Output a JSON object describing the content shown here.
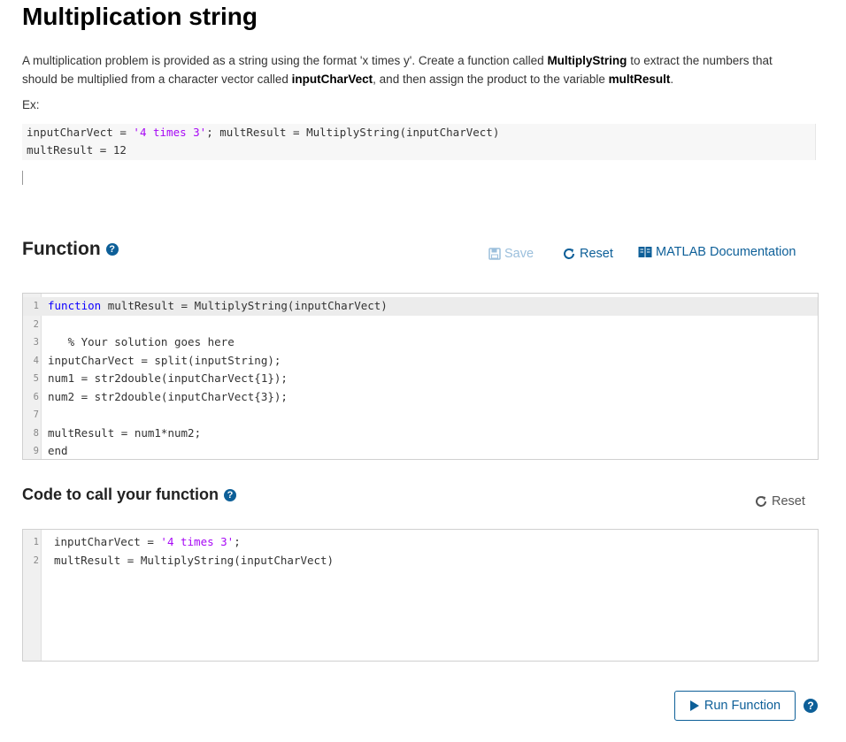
{
  "problem": {
    "title": "Multiplication string",
    "description_parts": [
      "A multiplication problem is provided as a string using the format 'x times y'. Create a function called ",
      "MultiplyString",
      " to extract the numbers that should be multiplied from a character vector called ",
      "inputCharVect",
      ", and then assign the product to the variable ",
      "multResult",
      "."
    ],
    "example_label": "Ex:",
    "example_lines": [
      {
        "pre": "inputCharVect = ",
        "str": "'4 times 3'",
        "post": "; multResult = MultiplyString(inputCharVect)"
      },
      {
        "pre": "multResult = 12",
        "str": "",
        "post": ""
      }
    ]
  },
  "function_section": {
    "title": "Function",
    "save_label": "Save",
    "reset_label": "Reset",
    "doc_label": "MATLAB Documentation",
    "code_lines": [
      {
        "n": "1",
        "kw": "function",
        "text": " multResult = MultiplyString(inputCharVect)"
      },
      {
        "n": "2",
        "kw": "",
        "text": ""
      },
      {
        "n": "3",
        "kw": "",
        "text": "   % Your solution goes here"
      },
      {
        "n": "4",
        "kw": "",
        "text": "inputCharVect = split(inputString);"
      },
      {
        "n": "5",
        "kw": "",
        "text": "num1 = str2double(inputCharVect{1});"
      },
      {
        "n": "6",
        "kw": "",
        "text": "num2 = str2double(inputCharVect{3});"
      },
      {
        "n": "7",
        "kw": "",
        "text": ""
      },
      {
        "n": "8",
        "kw": "",
        "text": "multResult = num1*num2;"
      },
      {
        "n": "9",
        "kw": "end",
        "text": ""
      }
    ]
  },
  "call_section": {
    "title": "Code to call your function",
    "reset_label": "Reset",
    "line1_pre": "inputCharVect = ",
    "line1_str": "'4 times 3'",
    "line1_post": ";",
    "line2": "multResult = MultiplyString(inputCharVect)",
    "line_numbers": [
      "1",
      "2"
    ]
  },
  "run_button": {
    "label": "Run Function"
  },
  "colors": {
    "accent": "#0d5f98",
    "string": "#a709f5",
    "keyword": "#0e00ff",
    "comment": "#228b22"
  }
}
